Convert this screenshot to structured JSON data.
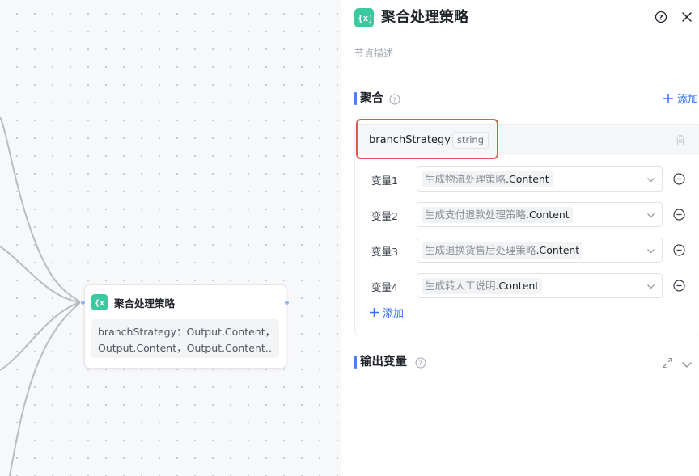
{
  "canvas": {
    "node": {
      "title": "聚合处理策略",
      "summary_line1": "branchStrategy：Output.Content，",
      "summary_line2": "Output.Content，Output.Content…"
    }
  },
  "panel": {
    "title": "聚合处理策略",
    "description_placeholder": "节点描述",
    "aggregate_section": {
      "title": "聚合",
      "add_label": "添加",
      "group": {
        "name": "branchStrategy",
        "type": "string"
      },
      "variables": [
        {
          "label": "变量1",
          "source": "生成物流处理策略",
          "field": ".Content"
        },
        {
          "label": "变量2",
          "source": "生成支付退款处理策略",
          "field": ".Content"
        },
        {
          "label": "变量3",
          "source": "生成退换货售后处理策略",
          "field": ".Content"
        },
        {
          "label": "变量4",
          "source": "生成转人工说明",
          "field": ".Content"
        }
      ],
      "add_variable_label": "添加"
    },
    "output_section": {
      "title": "输出变量"
    }
  },
  "colors": {
    "accent": "#3370ff",
    "node_icon": "#3cc8a0",
    "highlight": "#e5574e",
    "section_bar": "#4a7ef5"
  },
  "icons": {
    "node": "variable-braces-icon",
    "help": "question-circle-icon",
    "close": "close-icon",
    "add": "plus-icon",
    "delete": "trash-icon",
    "remove": "minus-circle-icon",
    "dropdown": "chevron-down-icon",
    "expand": "expand-icon",
    "collapse": "chevron-down-icon"
  }
}
